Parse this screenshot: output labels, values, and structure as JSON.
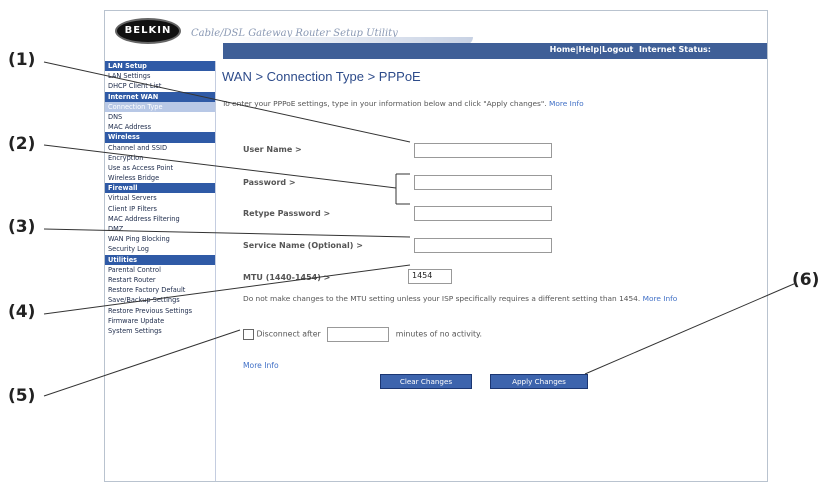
{
  "callouts": [
    "(1)",
    "(2)",
    "(3)",
    "(4)",
    "(5)",
    "(6)"
  ],
  "header": {
    "logo": "BELKIN",
    "utility_title": "Cable/DSL Gateway Router Setup Utility",
    "nav_home": "Home",
    "nav_help": "Help",
    "nav_logout": "Logout",
    "nav_internet_status": "Internet Status:"
  },
  "sidebar": {
    "items": [
      {
        "label": "LAN Setup",
        "type": "head"
      },
      {
        "label": "LAN Settings",
        "type": "item"
      },
      {
        "label": "DHCP Client List",
        "type": "item"
      },
      {
        "label": "Internet WAN",
        "type": "head"
      },
      {
        "label": "Connection Type",
        "type": "active"
      },
      {
        "label": "DNS",
        "type": "item"
      },
      {
        "label": "MAC Address",
        "type": "item"
      },
      {
        "label": "Wireless",
        "type": "head"
      },
      {
        "label": "Channel and SSID",
        "type": "item"
      },
      {
        "label": "Encryption",
        "type": "item"
      },
      {
        "label": "Use as Access Point",
        "type": "item"
      },
      {
        "label": "Wireless Bridge",
        "type": "item"
      },
      {
        "label": "Firewall",
        "type": "head"
      },
      {
        "label": "Virtual Servers",
        "type": "item"
      },
      {
        "label": "Client IP Filters",
        "type": "item"
      },
      {
        "label": "MAC Address Filtering",
        "type": "item"
      },
      {
        "label": "DMZ",
        "type": "item"
      },
      {
        "label": "WAN Ping Blocking",
        "type": "item"
      },
      {
        "label": "Security Log",
        "type": "item"
      },
      {
        "label": "Utilities",
        "type": "head"
      },
      {
        "label": "Parental Control",
        "type": "item"
      },
      {
        "label": "Restart Router",
        "type": "item"
      },
      {
        "label": "Restore Factory Default",
        "type": "item"
      },
      {
        "label": "Save/Backup Settings",
        "type": "item"
      },
      {
        "label": "Restore Previous Settings",
        "type": "item"
      },
      {
        "label": "Firmware Update",
        "type": "item"
      },
      {
        "label": "System Settings",
        "type": "item"
      }
    ]
  },
  "main": {
    "title": "WAN > Connection Type > PPPoE",
    "intro": "To enter your PPPoE settings, type in your information below and click \"Apply changes\".",
    "intro_more": "More Info",
    "user_name_label": "User Name >",
    "password_label": "Password >",
    "retype_password_label": "Retype Password >",
    "service_name_label": "Service Name (Optional) >",
    "mtu_label": "MTU (1440-1454) >",
    "mtu_value": "1454",
    "mtu_note": "Do not make changes to the MTU setting unless your ISP specifically requires a different setting than 1454.",
    "mtu_more": "More Info",
    "disconnect_label": "Disconnect after",
    "disconnect_suffix": "minutes of no activity.",
    "more_info": "More Info",
    "clear_button": "Clear Changes",
    "apply_button": "Apply Changes"
  },
  "colors": {
    "nav_bar": "#3f5f97",
    "sidebar_head": "#2f5aa6",
    "button": "#3d64ad",
    "title": "#2d4b8a"
  }
}
